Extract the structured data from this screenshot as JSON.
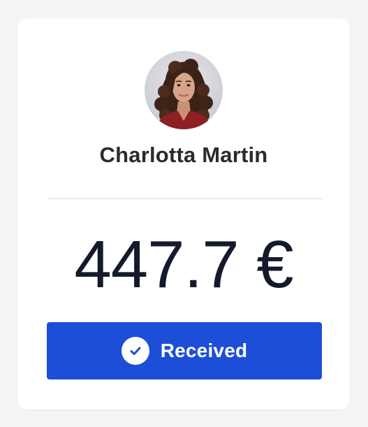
{
  "card": {
    "avatar": {
      "icon": "portrait-photo",
      "alt": ""
    },
    "name": "Charlotta Martin",
    "amount": "447.7 €",
    "status": {
      "label": "Received",
      "icon": "check-circle-icon",
      "color": "#1d4ed8"
    }
  }
}
